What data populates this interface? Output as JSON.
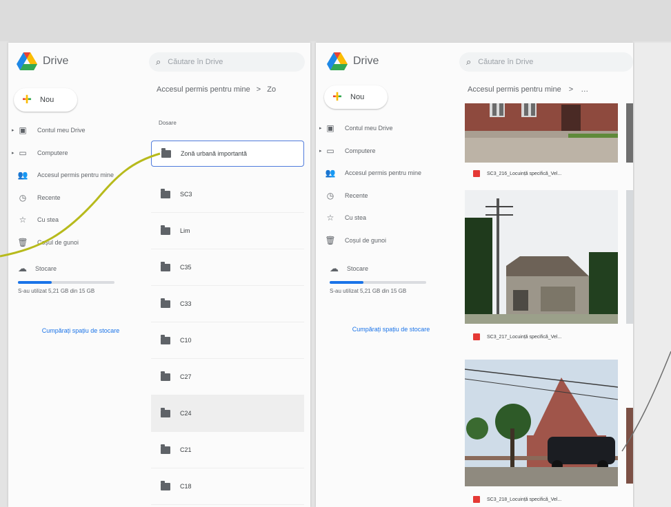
{
  "left": {
    "app_name": "Drive",
    "search_placeholder": "Căutare în Drive",
    "new_label": "Nou",
    "nav": [
      {
        "icon": "computer-drive-icon",
        "label": "Contul meu Drive",
        "arrow": true
      },
      {
        "icon": "computers-icon",
        "label": "Computere",
        "arrow": true
      },
      {
        "icon": "people-icon",
        "label": "Accesul permis pentru mine",
        "arrow": false
      },
      {
        "icon": "clock-icon",
        "label": "Recente",
        "arrow": false
      },
      {
        "icon": "star-icon",
        "label": "Cu stea",
        "arrow": false
      },
      {
        "icon": "trash-icon",
        "label": "Coșul de gunoi",
        "arrow": false
      }
    ],
    "storage_label": "Stocare",
    "storage_usage": "S-au utilizat 5,21 GB din 15 GB",
    "storage_fraction": 0.35,
    "buy_storage": "Cumpărați spațiu de stocare",
    "breadcrumb": "Accesul permis pentru mine",
    "breadcrumb_sep": ">",
    "breadcrumb_next": "Zo",
    "column_header": "Dosare",
    "folders": [
      "Zonă urbană importantă",
      "SC3",
      "Lim",
      "C35",
      "C33",
      "C10",
      "C27",
      "C24",
      "C21",
      "C18"
    ]
  },
  "right": {
    "app_name": "Drive",
    "search_placeholder": "Căutare în Drive",
    "new_label": "Nou",
    "nav": [
      {
        "icon": "computer-drive-icon",
        "label": "Contul meu Drive",
        "arrow": true
      },
      {
        "icon": "computers-icon",
        "label": "Computere",
        "arrow": true
      },
      {
        "icon": "people-icon",
        "label": "Accesul permis pentru mine",
        "arrow": false
      },
      {
        "icon": "clock-icon",
        "label": "Recente",
        "arrow": false
      },
      {
        "icon": "star-icon",
        "label": "Cu stea",
        "arrow": false
      },
      {
        "icon": "trash-icon",
        "label": "Coșul de gunoi",
        "arrow": false
      }
    ],
    "storage_label": "Stocare",
    "storage_usage": "S-au utilizat 5,21 GB din 15 GB",
    "storage_fraction": 0.35,
    "buy_storage": "Cumpărați spațiu de stocare",
    "breadcrumb": "Accesul permis pentru mine",
    "breadcrumb_sep": ">",
    "more": "…",
    "files": [
      "SC3_216_Locuință specifică_Vel...",
      "SC3_217_Locuință specifică_Vel...",
      "SC3_218_Locuință specifică_Vel..."
    ]
  },
  "colors": {
    "accent": "#1a73e8",
    "pdf_red": "#e53935",
    "annotation_yellow": "#b7ba1c",
    "annotation_gray": "#6d6d6d"
  }
}
